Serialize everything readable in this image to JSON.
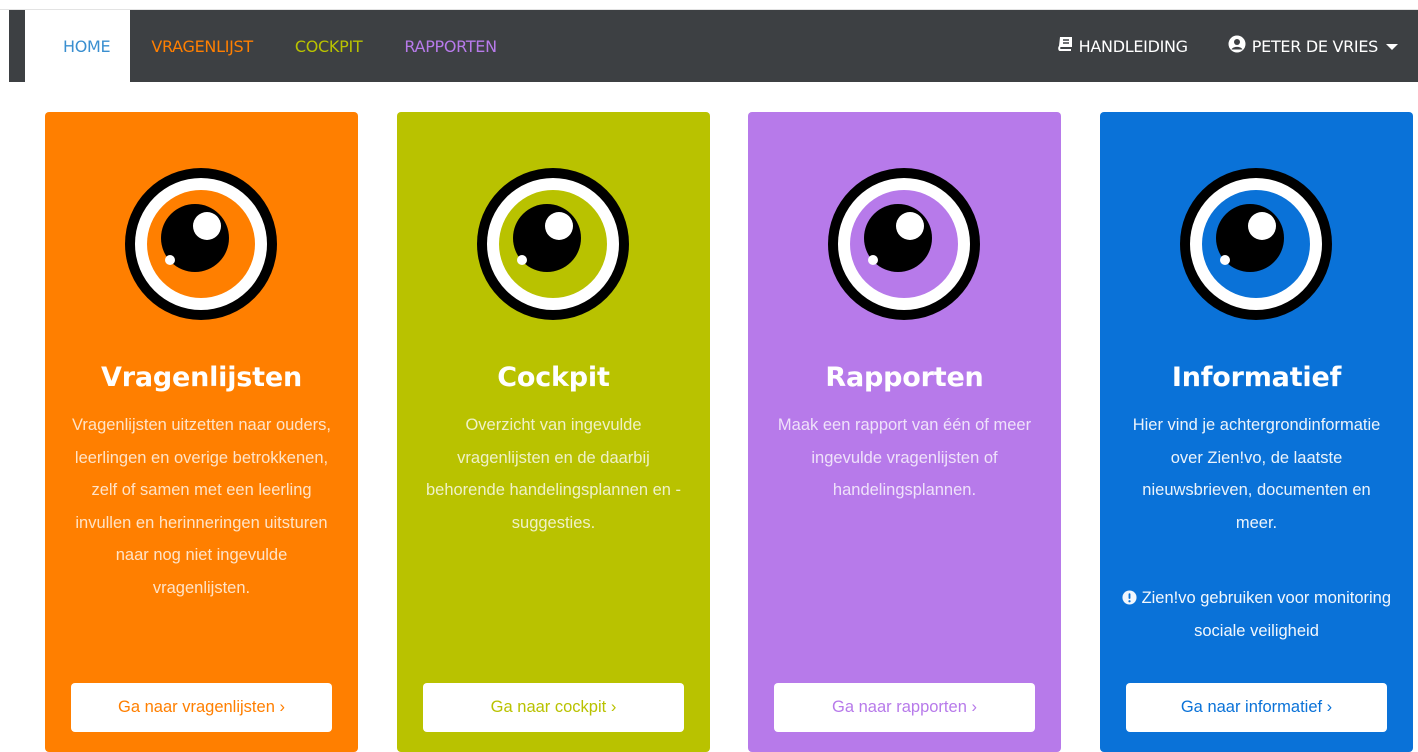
{
  "nav": {
    "home": "HOME",
    "vragenlijst": "VRAGENLIJST",
    "cockpit": "COCKPIT",
    "rapporten": "RAPPORTEN",
    "handleiding": "HANDLEIDING",
    "user": "PETER DE VRIES"
  },
  "colors": {
    "navbar": "#3d4043",
    "orange": "#ff7f00",
    "lime": "#b9c200",
    "purple": "#b77aea",
    "blue": "#0a72d8",
    "home_link": "#3a8fd0"
  },
  "cards": [
    {
      "title": "Vragenlijsten",
      "text": "Vragenlijsten uitzetten naar ouders, leerlingen en overige betrokkenen, zelf of samen met een leerling invullen en herinneringen uitsturen naar nog niet ingevulde vragenlijsten.",
      "button": "Ga naar vragenlijsten ›",
      "icon": "eye-icon"
    },
    {
      "title": "Cockpit",
      "text": "Overzicht van ingevulde vragenlijsten en de daarbij behorende handelingsplannen en -suggesties.",
      "button": "Ga naar cockpit ›",
      "icon": "eye-icon"
    },
    {
      "title": "Rapporten",
      "text": "Maak een rapport van één of meer ingevulde vragenlijsten of handelingsplannen.",
      "button": "Ga naar rapporten ›",
      "icon": "eye-icon"
    },
    {
      "title": "Informatief",
      "text": "Hier vind je achtergrondinformatie over Zien!vo, de laatste nieuwsbrieven, documenten en meer.",
      "note": "Zien!vo gebruiken voor monitoring sociale veiligheid",
      "button": "Ga naar informatief ›",
      "icon": "eye-icon"
    }
  ]
}
